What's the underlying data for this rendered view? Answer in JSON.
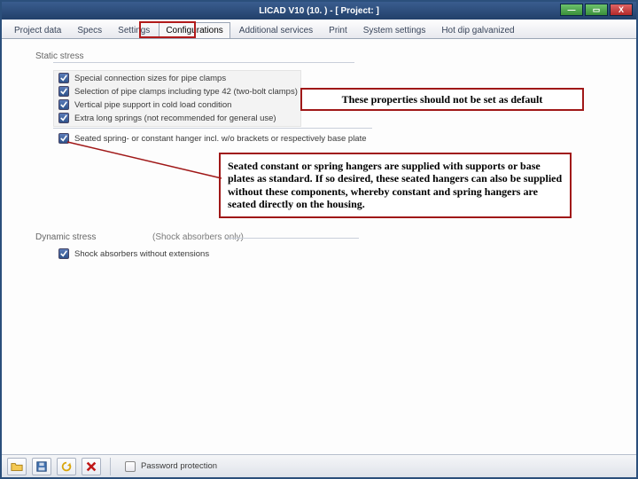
{
  "window": {
    "title": "LICAD V10 (10.    ) - [ Project:            ]"
  },
  "tabs": {
    "items": [
      {
        "label": "Project data"
      },
      {
        "label": "Specs"
      },
      {
        "label": "Settings"
      },
      {
        "label": "Configurations"
      },
      {
        "label": "Additional services"
      },
      {
        "label": "Print"
      },
      {
        "label": "System settings"
      },
      {
        "label": "Hot dip galvanized"
      }
    ],
    "active_index": 3
  },
  "sections": {
    "static_label": "Static stress",
    "dynamic_label": "Dynamic stress",
    "dynamic_note": "(Shock absorbers only)"
  },
  "static_options": [
    {
      "label": "Special connection sizes for pipe clamps",
      "checked": true
    },
    {
      "label": "Selection of pipe clamps including type 42 (two-bolt clamps)",
      "checked": true
    },
    {
      "label": "Vertical pipe support in cold load condition",
      "checked": true
    },
    {
      "label": "Extra long springs (not recommended for general use)",
      "checked": true
    },
    {
      "label": "Seated spring- or constant hanger incl. w/o brackets or respectively base plate",
      "checked": true
    }
  ],
  "dynamic_options": [
    {
      "label": "Shock absorbers without extensions",
      "checked": true
    }
  ],
  "callouts": {
    "top": "These properties should not be set as default",
    "main": "Seated constant or spring hangers are supplied with supports or base plates as standard. If so desired, these seated hangers can also be supplied without these components, whereby constant and spring hangers are seated directly on the housing."
  },
  "bottombar": {
    "password_label": "Password protection",
    "password_checked": false
  },
  "icons": {
    "check": "✓",
    "min": "—",
    "max": "▭",
    "close": "X"
  }
}
